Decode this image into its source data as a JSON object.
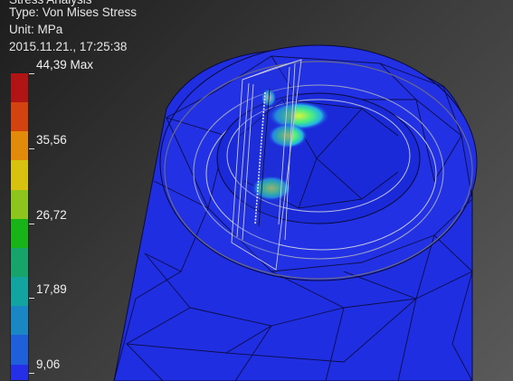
{
  "result_header": {
    "lines": [
      "Stress Analysis",
      "Type: Von Mises Stress",
      "Unit: MPa",
      "2015.11.21., 17:25:38"
    ]
  },
  "legend": {
    "max_label": "44,39 Max",
    "labels": [
      "35,56",
      "26,72",
      "17,89",
      "9,06"
    ],
    "colors": [
      "#b01414",
      "#d2430f",
      "#e28a0a",
      "#d8c20f",
      "#8ec51c",
      "#18b318",
      "#17a46a",
      "#12a4a0",
      "#1a86c4",
      "#1f5fd9",
      "#2530e6"
    ]
  },
  "model": {
    "colors": {
      "body": "#1f2ee0",
      "mesh": "#0a0a3a",
      "hotspot": "#4ef08e",
      "hotspot_peak": "#bff43a"
    }
  }
}
